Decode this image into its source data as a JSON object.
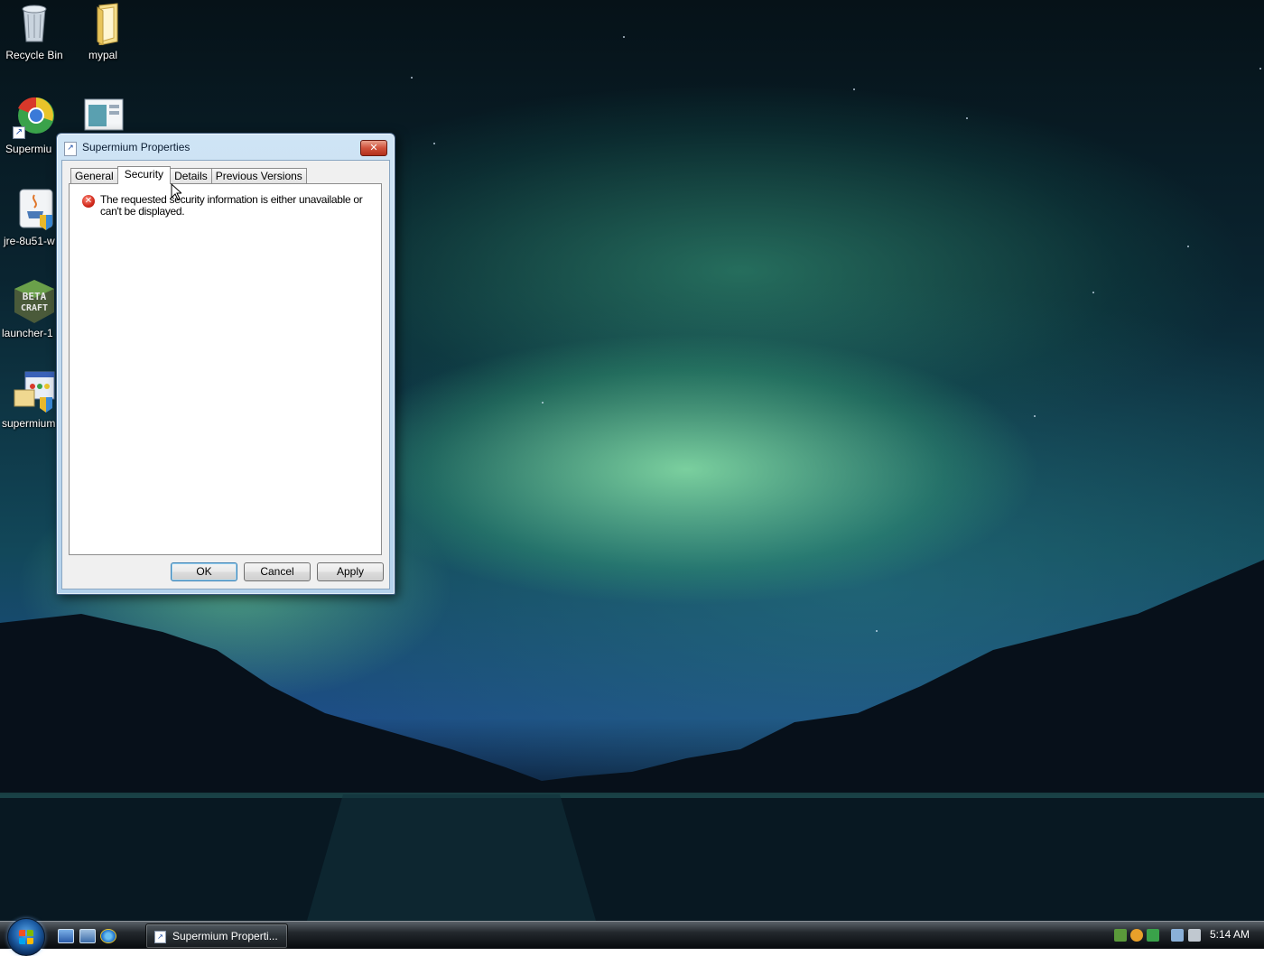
{
  "desktop": {
    "icons": [
      {
        "label": "Recycle Bin",
        "icon": "recycle-bin-icon"
      },
      {
        "label": "mypal",
        "icon": "folder-icon"
      },
      {
        "label": "Supermiu",
        "icon": "supermium-browser-icon"
      },
      {
        "label": "",
        "icon": "application-window-icon"
      },
      {
        "label": "jre-8u51-w",
        "icon": "java-installer-icon"
      },
      {
        "label": "launcher-1",
        "icon": "betacraft-launcher-icon"
      },
      {
        "label": "supermium",
        "icon": "installer-icon"
      }
    ]
  },
  "dialog": {
    "title": "Supermium Properties",
    "tabs": [
      {
        "label": "General"
      },
      {
        "label": "Security"
      },
      {
        "label": "Details"
      },
      {
        "label": "Previous Versions"
      }
    ],
    "active_tab": "Security",
    "error_message": "The requested security information is either unavailable or can't be displayed.",
    "buttons": {
      "ok": "OK",
      "cancel": "Cancel",
      "apply": "Apply"
    }
  },
  "taskbar": {
    "task_button_label": "Supermium Properti...",
    "clock": "5:14 AM"
  },
  "colors": {
    "accent": "#3c7fb1",
    "error_red": "#d0281a",
    "close_button_red": "#d0523c"
  }
}
